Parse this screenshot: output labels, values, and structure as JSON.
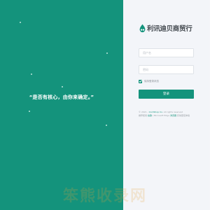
{
  "left": {
    "slogan": "“是否有核心，由你来确定。”"
  },
  "brand": {
    "name": "利讯迪贝商贸行",
    "accent_color": "#14937c",
    "logo_icon": "drop-cart-icon"
  },
  "form": {
    "username_placeholder": "用户名",
    "password_placeholder": "密码",
    "remember_label": "保持登录状态",
    "remember_checked": true,
    "login_label": "登录"
  },
  "footer": {
    "line1_prefix": "© 2021 - ",
    "line1_link": "CorkShop Co.",
    "line1_suffix": " All rights reserved",
    "line2_prefix": "推荐使用 ",
    "line2_link1": "谷歌",
    "line2_mid": " / Microsoft Edge ",
    "line2_link2": "浏览器",
    "line2_suffix": " 获得更佳体验"
  },
  "watermark": {
    "text": "笨熊收录网"
  }
}
